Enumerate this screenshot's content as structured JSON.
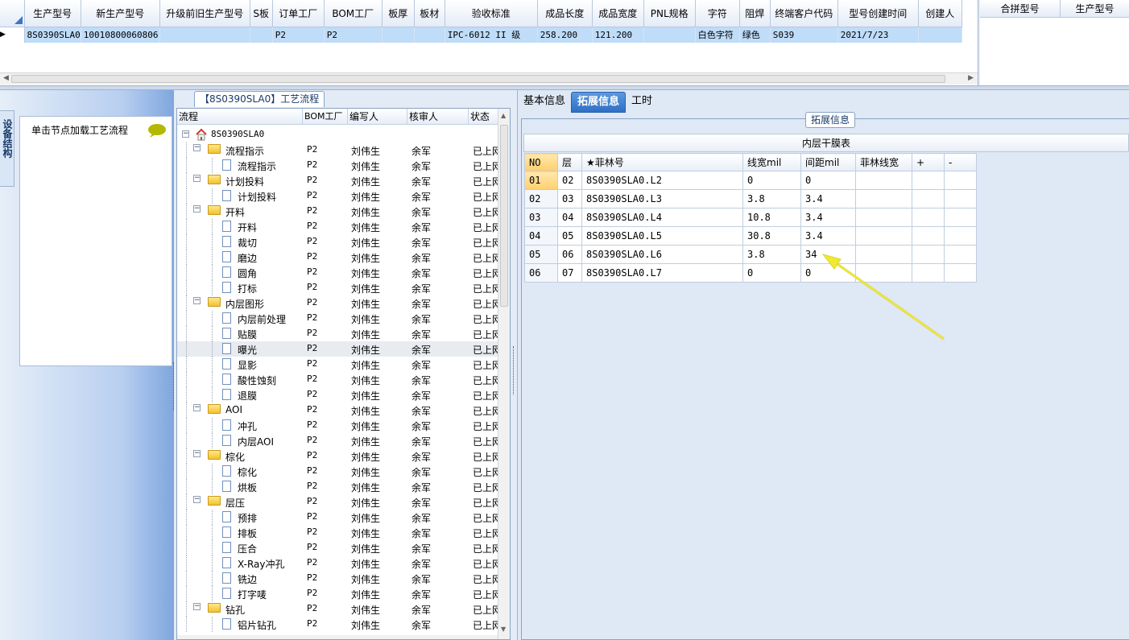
{
  "top_grid": {
    "columns": [
      "生产型号",
      "新生产型号",
      "升级前旧生产型号",
      "S板",
      "订单工厂",
      "BOM工厂",
      "板厚",
      "板材",
      "验收标准",
      "成品长度",
      "成品宽度",
      "PNL规格",
      "字符",
      "阻焊",
      "终端客户代码",
      "型号创建时间",
      "创建人"
    ],
    "row": [
      "8S0390SLA0",
      "10010800060806",
      "",
      "",
      "P2",
      "P2",
      "",
      "",
      "IPC-6012 II 级",
      "258.200",
      "121.200",
      "",
      "白色字符",
      "绿色",
      "S039",
      "2021/7/23",
      ""
    ]
  },
  "right_top": {
    "columns": [
      "合拼型号",
      "生产型号"
    ]
  },
  "sidebar": {
    "tab_label": "设备结构",
    "hint": "单击节点加载工艺流程"
  },
  "process": {
    "tab_title": "【8S0390SLA0】工艺流程",
    "columns": [
      "流程",
      "BOM工厂",
      "编写人",
      "核审人",
      "状态"
    ],
    "root": "8S0390SLA0",
    "rows": [
      {
        "name": "流程指示",
        "level": 1,
        "folder": true,
        "bom": "P2",
        "author": "刘伟生",
        "reviewer": "余军",
        "status": "已上网"
      },
      {
        "name": "流程指示",
        "level": 2,
        "folder": false,
        "bom": "P2",
        "author": "刘伟生",
        "reviewer": "余军",
        "status": "已上网"
      },
      {
        "name": "计划投料",
        "level": 1,
        "folder": true,
        "bom": "P2",
        "author": "刘伟生",
        "reviewer": "余军",
        "status": "已上网"
      },
      {
        "name": "计划投料",
        "level": 2,
        "folder": false,
        "bom": "P2",
        "author": "刘伟生",
        "reviewer": "余军",
        "status": "已上网"
      },
      {
        "name": "开料",
        "level": 1,
        "folder": true,
        "bom": "P2",
        "author": "刘伟生",
        "reviewer": "余军",
        "status": "已上网"
      },
      {
        "name": "开料",
        "level": 2,
        "folder": false,
        "bom": "P2",
        "author": "刘伟生",
        "reviewer": "余军",
        "status": "已上网"
      },
      {
        "name": "裁切",
        "level": 2,
        "folder": false,
        "bom": "P2",
        "author": "刘伟生",
        "reviewer": "余军",
        "status": "已上网"
      },
      {
        "name": "磨边",
        "level": 2,
        "folder": false,
        "bom": "P2",
        "author": "刘伟生",
        "reviewer": "余军",
        "status": "已上网"
      },
      {
        "name": "圆角",
        "level": 2,
        "folder": false,
        "bom": "P2",
        "author": "刘伟生",
        "reviewer": "余军",
        "status": "已上网"
      },
      {
        "name": "打标",
        "level": 2,
        "folder": false,
        "bom": "P2",
        "author": "刘伟生",
        "reviewer": "余军",
        "status": "已上网"
      },
      {
        "name": "内层图形",
        "level": 1,
        "folder": true,
        "bom": "P2",
        "author": "刘伟生",
        "reviewer": "余军",
        "status": "已上网"
      },
      {
        "name": "内层前处理",
        "level": 2,
        "folder": false,
        "bom": "P2",
        "author": "刘伟生",
        "reviewer": "余军",
        "status": "已上网"
      },
      {
        "name": "贴膜",
        "level": 2,
        "folder": false,
        "bom": "P2",
        "author": "刘伟生",
        "reviewer": "余军",
        "status": "已上网"
      },
      {
        "name": "曝光",
        "level": 2,
        "folder": false,
        "bom": "P2",
        "author": "刘伟生",
        "reviewer": "余军",
        "status": "已上网",
        "selected": true
      },
      {
        "name": "显影",
        "level": 2,
        "folder": false,
        "bom": "P2",
        "author": "刘伟生",
        "reviewer": "余军",
        "status": "已上网"
      },
      {
        "name": "酸性蚀刻",
        "level": 2,
        "folder": false,
        "bom": "P2",
        "author": "刘伟生",
        "reviewer": "余军",
        "status": "已上网"
      },
      {
        "name": "退膜",
        "level": 2,
        "folder": false,
        "bom": "P2",
        "author": "刘伟生",
        "reviewer": "余军",
        "status": "已上网"
      },
      {
        "name": "AOI",
        "level": 1,
        "folder": true,
        "bom": "P2",
        "author": "刘伟生",
        "reviewer": "余军",
        "status": "已上网"
      },
      {
        "name": "冲孔",
        "level": 2,
        "folder": false,
        "bom": "P2",
        "author": "刘伟生",
        "reviewer": "余军",
        "status": "已上网"
      },
      {
        "name": "内层AOI",
        "level": 2,
        "folder": false,
        "bom": "P2",
        "author": "刘伟生",
        "reviewer": "余军",
        "status": "已上网"
      },
      {
        "name": "棕化",
        "level": 1,
        "folder": true,
        "bom": "P2",
        "author": "刘伟生",
        "reviewer": "余军",
        "status": "已上网"
      },
      {
        "name": "棕化",
        "level": 2,
        "folder": false,
        "bom": "P2",
        "author": "刘伟生",
        "reviewer": "余军",
        "status": "已上网"
      },
      {
        "name": "烘板",
        "level": 2,
        "folder": false,
        "bom": "P2",
        "author": "刘伟生",
        "reviewer": "余军",
        "status": "已上网"
      },
      {
        "name": "层压",
        "level": 1,
        "folder": true,
        "bom": "P2",
        "author": "刘伟生",
        "reviewer": "余军",
        "status": "已上网"
      },
      {
        "name": "预排",
        "level": 2,
        "folder": false,
        "bom": "P2",
        "author": "刘伟生",
        "reviewer": "余军",
        "status": "已上网"
      },
      {
        "name": "排板",
        "level": 2,
        "folder": false,
        "bom": "P2",
        "author": "刘伟生",
        "reviewer": "余军",
        "status": "已上网"
      },
      {
        "name": "压合",
        "level": 2,
        "folder": false,
        "bom": "P2",
        "author": "刘伟生",
        "reviewer": "余军",
        "status": "已上网"
      },
      {
        "name": "X-Ray冲孔",
        "level": 2,
        "folder": false,
        "bom": "P2",
        "author": "刘伟生",
        "reviewer": "余军",
        "status": "已上网"
      },
      {
        "name": "铣边",
        "level": 2,
        "folder": false,
        "bom": "P2",
        "author": "刘伟生",
        "reviewer": "余军",
        "status": "已上网"
      },
      {
        "name": "打字唛",
        "level": 2,
        "folder": false,
        "bom": "P2",
        "author": "刘伟生",
        "reviewer": "余军",
        "status": "已上网"
      },
      {
        "name": "钻孔",
        "level": 1,
        "folder": true,
        "bom": "P2",
        "author": "刘伟生",
        "reviewer": "余军",
        "status": "已上网"
      },
      {
        "name": "铝片钻孔",
        "level": 2,
        "folder": false,
        "bom": "P2",
        "author": "刘伟生",
        "reviewer": "余军",
        "status": "已上网"
      }
    ]
  },
  "tabs": [
    {
      "label": "基本信息",
      "active": false
    },
    {
      "label": "拓展信息",
      "active": true
    },
    {
      "label": "工时",
      "active": false
    }
  ],
  "ext": {
    "legend": "拓展信息",
    "table_caption": "内层干膜表",
    "columns": [
      "NO",
      "层",
      "★菲林号",
      "线宽mil",
      "间距mil",
      "菲林线宽",
      "+",
      "-"
    ],
    "rows": [
      [
        "01",
        "02",
        "8S0390SLA0.L2",
        "0",
        "0",
        "",
        "",
        ""
      ],
      [
        "02",
        "03",
        "8S0390SLA0.L3",
        "3.8",
        "3.4",
        "",
        "",
        ""
      ],
      [
        "03",
        "04",
        "8S0390SLA0.L4",
        "10.8",
        "3.4",
        "",
        "",
        ""
      ],
      [
        "04",
        "05",
        "8S0390SLA0.L5",
        "30.8",
        "3.4",
        "",
        "",
        ""
      ],
      [
        "05",
        "06",
        "8S0390SLA0.L6",
        "3.8",
        "34",
        "",
        "",
        ""
      ],
      [
        "06",
        "07",
        "8S0390SLA0.L7",
        "0",
        "0",
        "",
        "",
        ""
      ]
    ]
  },
  "colors": {
    "selection": "#bfdcf8",
    "active_tab": "#3a7ed0",
    "annotation_arrow": "#f0ea2c",
    "folder": "#f2c230"
  }
}
